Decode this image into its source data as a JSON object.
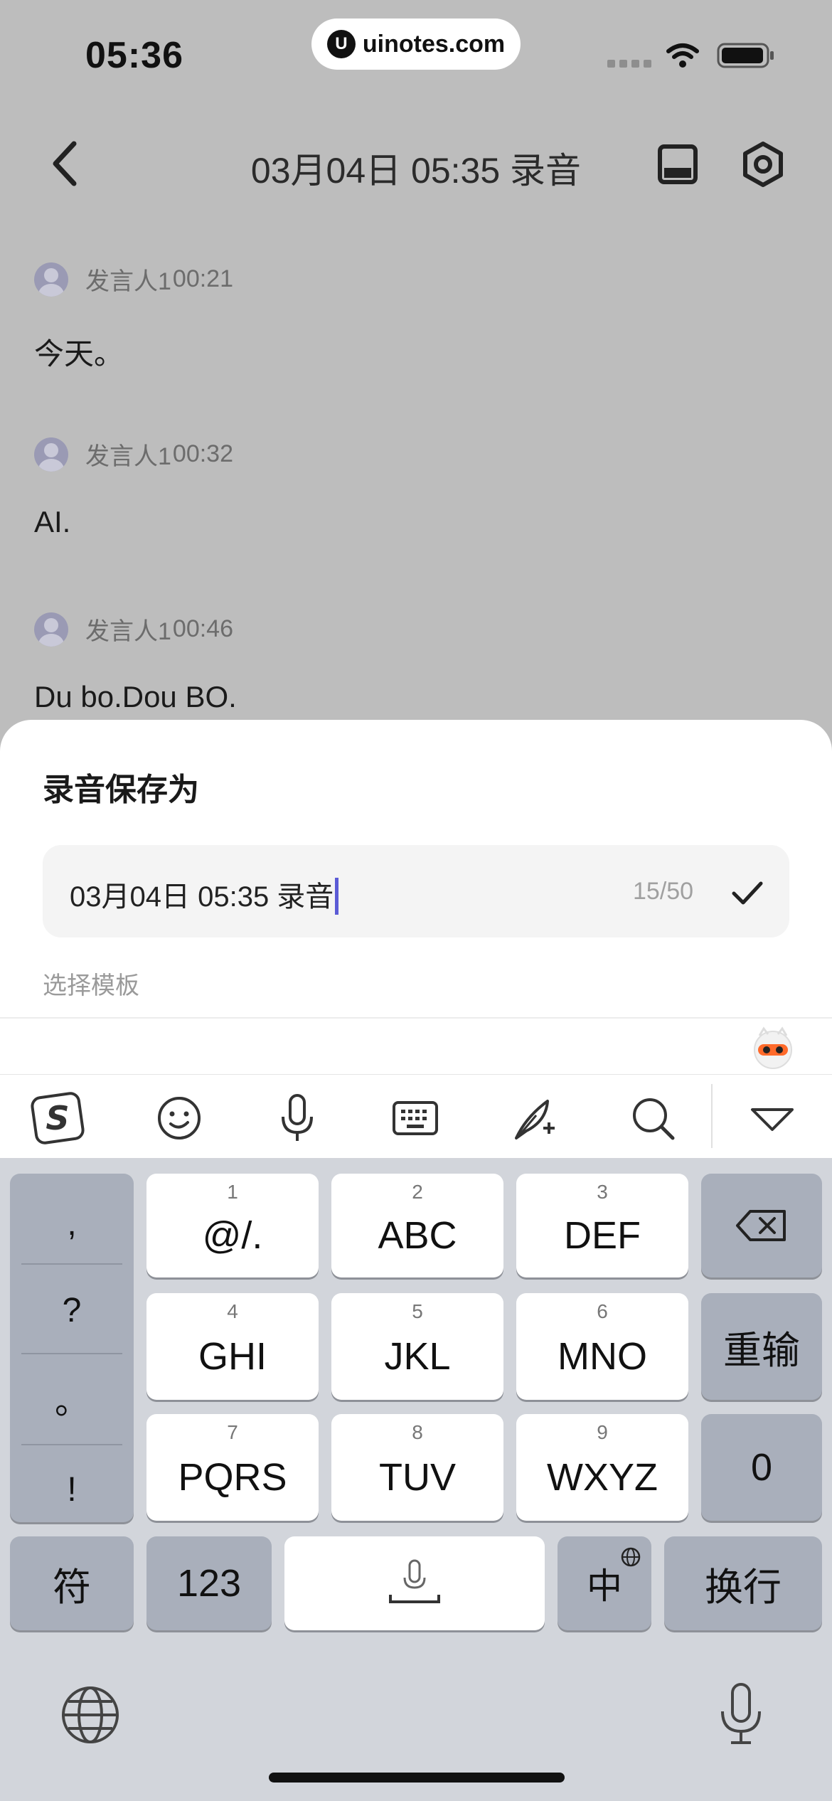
{
  "status_bar": {
    "time": "05:36",
    "url": "uinotes.com",
    "url_icon_letter": "U"
  },
  "nav": {
    "title": "03月04日 05:35 录音"
  },
  "transcript": [
    {
      "speaker": "发言人1",
      "time": "00:21",
      "text": "今天。"
    },
    {
      "speaker": "发言人1",
      "time": "00:32",
      "text": "AI."
    },
    {
      "speaker": "发言人1",
      "time": "00:46",
      "text": "Du bo.Dou BO."
    }
  ],
  "sheet": {
    "title": "录音保存为",
    "name_value": "03月04日 05:35 录音",
    "counter": "15/50",
    "template_label": "选择模板"
  },
  "keyboard": {
    "punctuation": [
      ",",
      "?",
      "。",
      "!"
    ],
    "keys": [
      {
        "num": "1",
        "label": "@/."
      },
      {
        "num": "2",
        "label": "ABC"
      },
      {
        "num": "3",
        "label": "DEF"
      },
      {
        "num": "4",
        "label": "GHI"
      },
      {
        "num": "5",
        "label": "JKL"
      },
      {
        "num": "6",
        "label": "MNO"
      },
      {
        "num": "7",
        "label": "PQRS"
      },
      {
        "num": "8",
        "label": "TUV"
      },
      {
        "num": "9",
        "label": "WXYZ"
      }
    ],
    "reenter": "重输",
    "zero": "0",
    "symbols": "符",
    "numbers": "123",
    "chinese": "中",
    "newline": "换行"
  },
  "icons": {
    "accent": "#5b5bd6",
    "toolbar": [
      "sogou-logo-icon",
      "emoji-icon",
      "microphone-icon",
      "keyboard-icon",
      "handwriting-icon",
      "search-icon",
      "collapse-icon"
    ]
  }
}
